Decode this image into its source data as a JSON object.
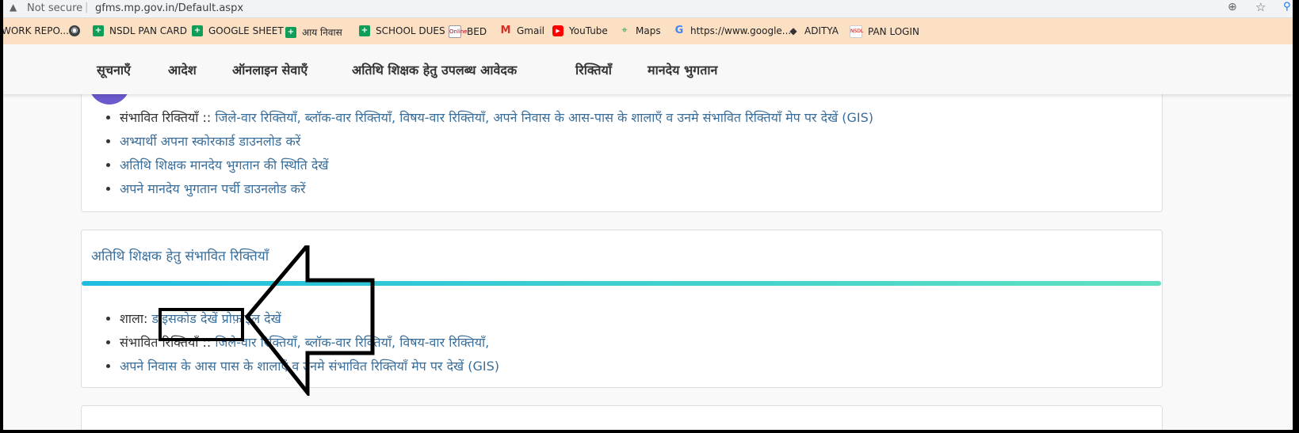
{
  "browser": {
    "security_label": "Not secure",
    "url": "gfms.mp.gov.in/Default.aspx",
    "bookmarks": [
      {
        "label": "WORK REPO...",
        "icon": "none"
      },
      {
        "label": "",
        "icon": "globe-icon"
      },
      {
        "label": "NSDL PAN CARD",
        "icon": "sheets-icon"
      },
      {
        "label": "GOOGLE SHEET",
        "icon": "sheets-icon"
      },
      {
        "label": "आय निवास",
        "icon": "sheets-icon"
      },
      {
        "label": "SCHOOL DUES",
        "icon": "sheets-icon"
      },
      {
        "label": "BED",
        "icon": "online-icon"
      },
      {
        "label": "Gmail",
        "icon": "gmail-icon"
      },
      {
        "label": "YouTube",
        "icon": "youtube-icon"
      },
      {
        "label": "Maps",
        "icon": "maps-icon"
      },
      {
        "label": "https://www.google...",
        "icon": "google-icon"
      },
      {
        "label": "ADITYA",
        "icon": "cap-icon"
      },
      {
        "label": "PAN LOGIN",
        "icon": "nsdl-icon"
      }
    ]
  },
  "nav": {
    "items": [
      "सूचनाएँ",
      "आदेश",
      "ऑनलाइन सेवाएँ",
      "अतिथि शिक्षक हेतु उपलब्ध आवेदक",
      "रिक्तियाँ",
      "मानदेय भुगतान"
    ]
  },
  "card1": {
    "item1_prefix": "संभावित रिक्तियाँ :: ",
    "item1_link": "जिले-वार रिक्तियाँ, ब्लॉक-वार रिक्तियाँ, विषय-वार रिक्तियाँ, अपने निवास के आस-पास के शालाएँ व उनमे संभावित रिक्तियाँ मेप पर देखें (GIS)",
    "item2": "अभ्यार्थी अपना स्कोरकार्ड डाउनलोड करें",
    "item3": "अतिथि शिक्षक मानदेय भुगतान की स्थिति देखें",
    "item4": "अपने मानदेय भुगतान पर्ची डाउनलोड करें"
  },
  "card2": {
    "title": "अतिथि शिक्षक हेतु संभावित रिक्तियाँ",
    "item1_prefix": "शाला: ",
    "item1_link_a": "डाइसकोड देखें",
    "item1_sep": " ",
    "item1_link_b": "प्रोफ़ाइल देखें",
    "item2_prefix": "संभावित रिक्तियाँ :: ",
    "item2_link": "जिले-वार रिक्तियाँ, ब्लॉक-वार रिक्तियाँ, विषय-वार रिक्तियाँ,",
    "item3": "अपने निवास के आस पास के शालाएँ व उनमे संभावित रिक्तियाँ मेप पर देखें (GIS)"
  }
}
